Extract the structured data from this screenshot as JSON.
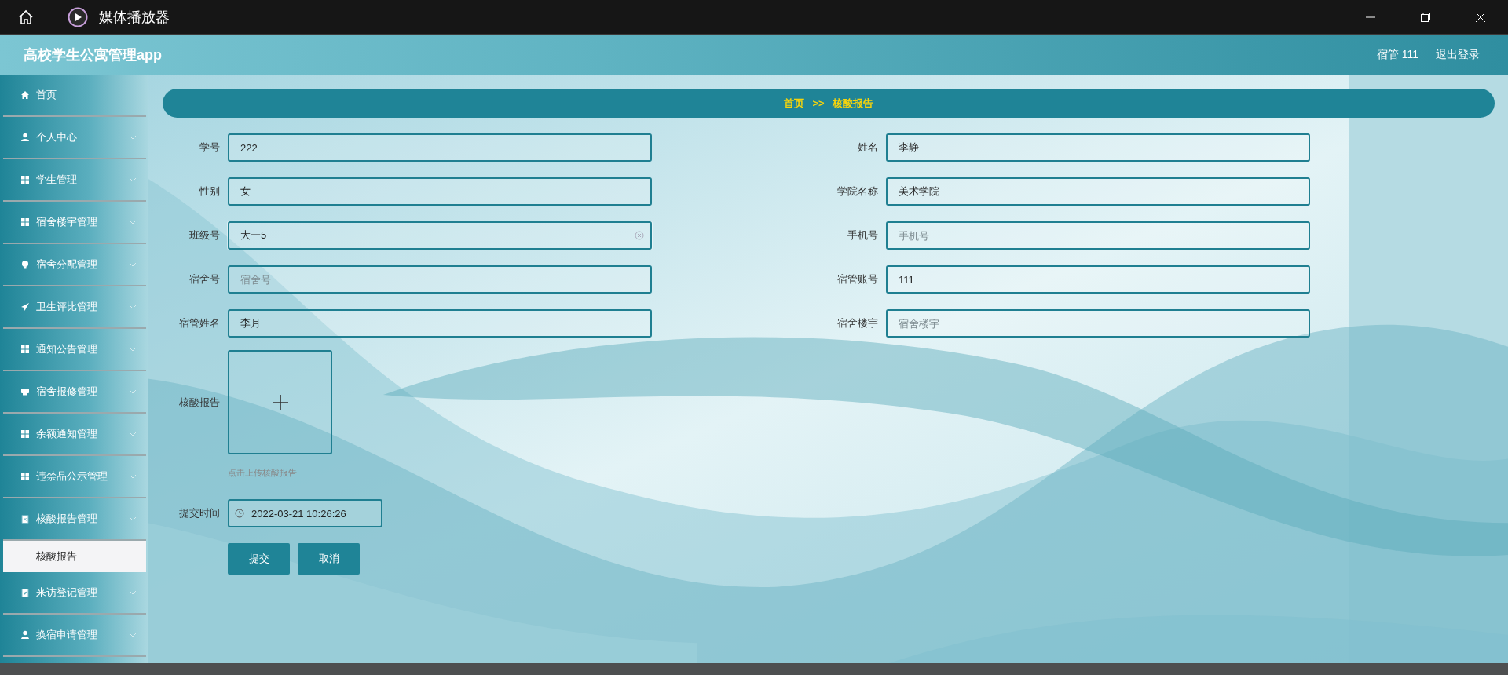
{
  "window": {
    "title": "媒体播放器"
  },
  "header": {
    "app_title": "高校学生公寓管理app",
    "user": "宿管 111",
    "logout": "退出登录"
  },
  "sidebar": {
    "items": [
      {
        "label": "首页",
        "expandable": false
      },
      {
        "label": "个人中心",
        "expandable": true
      },
      {
        "label": "学生管理",
        "expandable": true
      },
      {
        "label": "宿舍楼宇管理",
        "expandable": true
      },
      {
        "label": "宿舍分配管理",
        "expandable": true
      },
      {
        "label": "卫生评比管理",
        "expandable": true
      },
      {
        "label": "通知公告管理",
        "expandable": true
      },
      {
        "label": "宿舍报修管理",
        "expandable": true
      },
      {
        "label": "余额通知管理",
        "expandable": true
      },
      {
        "label": "违禁品公示管理",
        "expandable": true
      },
      {
        "label": "核酸报告管理",
        "expandable": true,
        "expanded": true,
        "children": [
          {
            "label": "核酸报告",
            "selected": true
          }
        ]
      },
      {
        "label": "来访登记管理",
        "expandable": true
      },
      {
        "label": "换宿申请管理",
        "expandable": true
      }
    ]
  },
  "breadcrumb": {
    "items": [
      "首页",
      "核酸报告"
    ],
    "separator": ">>"
  },
  "form": {
    "rows": [
      {
        "left": {
          "label": "学号",
          "value": "222",
          "focused": false
        },
        "right": {
          "label": "姓名",
          "value": "李静",
          "focused": false
        }
      },
      {
        "left": {
          "label": "性别",
          "value": "女",
          "focused": false
        },
        "right": {
          "label": "学院名称",
          "value": "美术学院",
          "focused": false
        }
      },
      {
        "left": {
          "label": "班级号",
          "value": "大一5",
          "focused": true
        },
        "right": {
          "label": "手机号",
          "placeholder": "手机号",
          "focused": false
        }
      },
      {
        "left": {
          "label": "宿舍号",
          "placeholder": "宿舍号",
          "focused": false
        },
        "right": {
          "label": "宿管账号",
          "value": "111",
          "focused": false
        }
      },
      {
        "left": {
          "label": "宿管姓名",
          "value": "李月",
          "focused": false
        },
        "right": {
          "label": "宿舍楼宇",
          "placeholder": "宿舍楼宇",
          "focused": false
        }
      }
    ],
    "upload": {
      "label": "核酸报告",
      "hint": "点击上传核酸报告"
    },
    "time": {
      "label": "提交时间",
      "value": "2022-03-21 10:26:26"
    },
    "buttons": [
      "提交",
      "取消"
    ]
  }
}
